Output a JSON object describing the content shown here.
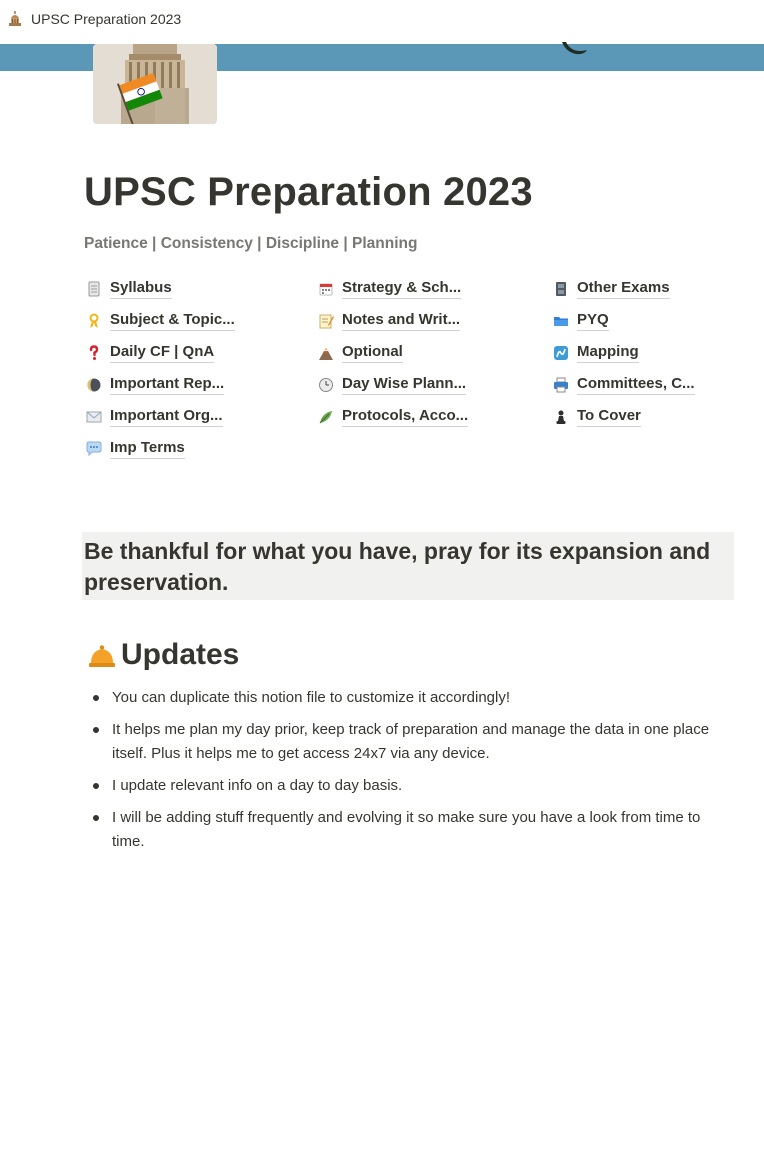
{
  "tab": {
    "title": "UPSC Preparation 2023",
    "icon": "building-dome-icon"
  },
  "page": {
    "title": "UPSC Preparation 2023",
    "subtitle": "Patience | Consistency | Discipline | Planning"
  },
  "links": {
    "col1": [
      {
        "label": "Syllabus",
        "icon": "page-document-icon"
      },
      {
        "label": "Subject & Topic...",
        "icon": "ribbon-icon"
      },
      {
        "label": "Daily CF | QnA",
        "icon": "question-mark-icon"
      },
      {
        "label": "Important Rep...",
        "icon": "moon-icon"
      },
      {
        "label": "Important Org...",
        "icon": "envelope-icon"
      },
      {
        "label": "Imp Terms",
        "icon": "speech-bubble-icon"
      }
    ],
    "col2": [
      {
        "label": "Strategy & Sch...",
        "icon": "calendar-icon"
      },
      {
        "label": "Notes and Writ...",
        "icon": "memo-icon"
      },
      {
        "label": "Optional",
        "icon": "volcano-icon"
      },
      {
        "label": "Day Wise Plann...",
        "icon": "clock-icon"
      },
      {
        "label": "Protocols, Acco...",
        "icon": "leaf-icon"
      }
    ],
    "col3": [
      {
        "label": "Other Exams",
        "icon": "file-cabinet-icon"
      },
      {
        "label": "PYQ",
        "icon": "folder-icon"
      },
      {
        "label": "Mapping",
        "icon": "map-curve-icon"
      },
      {
        "label": "Committees, C...",
        "icon": "printer-icon"
      },
      {
        "label": "To Cover",
        "icon": "chess-pawn-icon"
      }
    ]
  },
  "quote": " Be thankful for what you have, pray for its expansion and preservation.",
  "updates": {
    "heading": "Updates",
    "icon": "bell-icon",
    "items": [
      "You can duplicate this notion file to customize it accordingly!",
      "It helps me plan my day prior, keep track of preparation and manage the data in one place itself. Plus it helps me to get access 24x7 via any device.",
      "I update relevant info on a day to day basis.",
      "I will be adding stuff frequently and evolving it so make sure you have a look from time to time."
    ]
  },
  "colors": {
    "accent_blue": "#5b97b6",
    "quote_bg": "#f1f1ef",
    "text": "#37352f",
    "muted": "#787774"
  }
}
